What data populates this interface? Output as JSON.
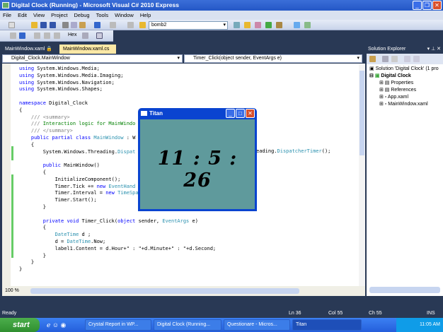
{
  "window": {
    "title": "Digital Clock (Running) - Microsoft Visual C# 2010 Express"
  },
  "menu": [
    "File",
    "Edit",
    "View",
    "Project",
    "Debug",
    "Tools",
    "Window",
    "Help"
  ],
  "toolbar": {
    "config_value": "bomb2",
    "hex_label": "Hex"
  },
  "tabs": [
    {
      "label": "MainWindow.xaml"
    },
    {
      "label": "MainWindow.xaml.cs"
    }
  ],
  "nav": {
    "type": "Digital_Clock.MainWindow",
    "member": "Timer_Click(object sender, EventArgs e)"
  },
  "code": {
    "lines": [
      [
        [
          "using",
          "kw"
        ],
        [
          " System.Windows.Media;",
          ""
        ]
      ],
      [
        [
          "using",
          "kw"
        ],
        [
          " System.Windows.Media.Imaging;",
          ""
        ]
      ],
      [
        [
          "using",
          "kw"
        ],
        [
          " System.Windows.Navigation;",
          ""
        ]
      ],
      [
        [
          "using",
          "kw"
        ],
        [
          " System.Windows.Shapes;",
          ""
        ]
      ],
      [],
      [
        [
          "namespace",
          "kw"
        ],
        [
          " Digital_Clock",
          ""
        ]
      ],
      [
        [
          "{",
          ""
        ]
      ],
      [
        [
          "    /// ",
          "cg"
        ],
        [
          "<summary>",
          "cg"
        ]
      ],
      [
        [
          "    /// ",
          "cg"
        ],
        [
          "Interaction logic for MainWindo",
          "cm"
        ]
      ],
      [
        [
          "    /// ",
          "cg"
        ],
        [
          "</summary>",
          "cg"
        ]
      ],
      [
        [
          "    ",
          ""
        ],
        [
          "public",
          "kw"
        ],
        [
          " ",
          ""
        ],
        [
          "partial",
          "kw"
        ],
        [
          " ",
          ""
        ],
        [
          "class",
          "kw"
        ],
        [
          " ",
          ""
        ],
        [
          "MainWindow",
          "ty"
        ],
        [
          " : W",
          ""
        ]
      ],
      [
        [
          "    {",
          ""
        ]
      ],
      [
        [
          "        System.Windows.Threading.",
          ""
        ],
        [
          "Dispat",
          "ty"
        ]
      ],
      [],
      [
        [
          "        ",
          ""
        ],
        [
          "public",
          "kw"
        ],
        [
          " MainWindow()",
          ""
        ]
      ],
      [
        [
          "        {",
          ""
        ]
      ],
      [
        [
          "            InitializeComponent();",
          ""
        ]
      ],
      [
        [
          "            Timer.Tick += ",
          ""
        ],
        [
          "new",
          "kw"
        ],
        [
          " ",
          ""
        ],
        [
          "EventHand",
          "ty"
        ]
      ],
      [
        [
          "            Timer.Interval = ",
          ""
        ],
        [
          "new",
          "kw"
        ],
        [
          " ",
          ""
        ],
        [
          "TimeSpa",
          "ty"
        ]
      ],
      [
        [
          "            Timer.Start();",
          ""
        ]
      ],
      [
        [
          "        }",
          ""
        ]
      ],
      [],
      [
        [
          "        ",
          ""
        ],
        [
          "private",
          "kw"
        ],
        [
          " ",
          ""
        ],
        [
          "void",
          "kw"
        ],
        [
          " Timer_Click(",
          ""
        ],
        [
          "object",
          "kw"
        ],
        [
          " sender, ",
          ""
        ],
        [
          "EventArgs",
          "ty"
        ],
        [
          " e)",
          ""
        ]
      ],
      [
        [
          "        {",
          ""
        ]
      ],
      [
        [
          "            ",
          ""
        ],
        [
          "DateTime",
          "ty"
        ],
        [
          " d ;",
          ""
        ]
      ],
      [
        [
          "            d = ",
          ""
        ],
        [
          "DateTime",
          "ty"
        ],
        [
          ".Now;",
          ""
        ]
      ],
      [
        [
          "            label1.Content = d.Hour+\" : \"+d.Minute+\" : \"+d.Second;",
          ""
        ]
      ],
      [
        [
          "        }",
          ""
        ]
      ],
      [
        [
          "    }",
          ""
        ]
      ],
      [
        [
          "}",
          ""
        ]
      ]
    ],
    "overflow_right": [
      [
        "eading.",
        ""
      ],
      [
        "DispatcherTimer",
        "ty"
      ],
      [
        "();",
        ""
      ]
    ]
  },
  "zoom": "100 %",
  "solution_explorer": {
    "title": "Solution Explorer",
    "solution": "Solution 'Digital Clock' (1 pro",
    "project": "Digital Clock",
    "items": [
      "Properties",
      "References",
      "App.xaml",
      "MainWindow.xaml"
    ]
  },
  "status": {
    "text": "Ready",
    "ln": "Ln 36",
    "col": "Col 55",
    "ch": "Ch 55",
    "mode": "INS"
  },
  "taskbar": {
    "start": "start",
    "tasks": [
      "Crystal Report in WP...",
      "Digital Clock (Running...",
      "Questionare - Micros...",
      "Titan"
    ],
    "time": "11:05 AM"
  },
  "titan": {
    "title": "Titan",
    "clock": "11 : 5 : 26"
  }
}
